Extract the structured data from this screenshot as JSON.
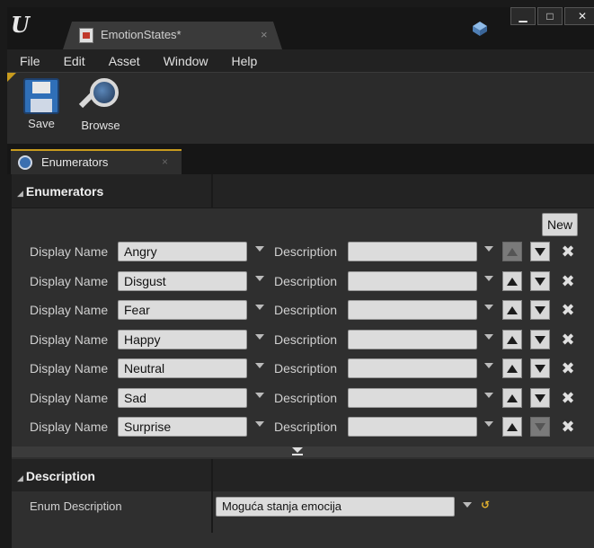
{
  "window": {
    "logo": "U",
    "tab_title": "EmotionStates*",
    "tab_close": "×",
    "source_control_icon": "source-control-icon",
    "min": "▁",
    "max": "□",
    "close": "✕"
  },
  "menu": [
    "File",
    "Edit",
    "Asset",
    "Window",
    "Help"
  ],
  "toolbar": {
    "save_label": "Save",
    "browse_label": "Browse"
  },
  "panel_tab": {
    "label": "Enumerators",
    "close": "×"
  },
  "enumerators_section": {
    "title": "Enumerators",
    "new_label": "New",
    "display_name_label": "Display Name",
    "description_label": "Description",
    "remove_glyph": "✖",
    "rows": [
      {
        "name": "Angry",
        "description": "",
        "up_enabled": false,
        "down_enabled": true
      },
      {
        "name": "Disgust",
        "description": "",
        "up_enabled": true,
        "down_enabled": true
      },
      {
        "name": "Fear",
        "description": "",
        "up_enabled": true,
        "down_enabled": true
      },
      {
        "name": "Happy",
        "description": "",
        "up_enabled": true,
        "down_enabled": true
      },
      {
        "name": "Neutral",
        "description": "",
        "up_enabled": true,
        "down_enabled": true
      },
      {
        "name": "Sad",
        "description": "",
        "up_enabled": true,
        "down_enabled": true
      },
      {
        "name": "Surprise",
        "description": "",
        "up_enabled": true,
        "down_enabled": false
      }
    ]
  },
  "description_section": {
    "title": "Description",
    "label": "Enum Description",
    "value": "Moguća stanja emocija",
    "reset_glyph": "↺"
  },
  "colors": {
    "accent": "#c89b1e",
    "panel_bg": "#2f2f2f",
    "field_bg": "#dcdcdc"
  }
}
